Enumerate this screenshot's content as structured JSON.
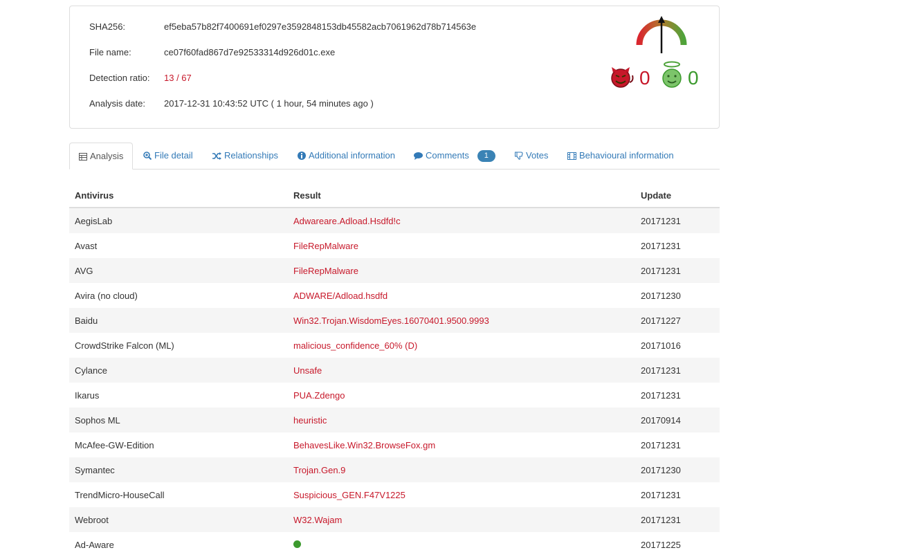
{
  "summary": {
    "sha256_label": "SHA256:",
    "sha256_value": "ef5eba57b82f7400691ef0297e3592848153db45582acb7061962d78b714563e",
    "filename_label": "File name:",
    "filename_value": "ce07f60fad867d7e92533314d926d01c.exe",
    "ratio_label": "Detection ratio:",
    "ratio_value": "13 / 67",
    "date_label": "Analysis date:",
    "date_value": "2017-12-31 10:43:52 UTC ( 1 hour, 54 minutes ago )"
  },
  "votes": {
    "malicious_count": "0",
    "harmless_count": "0",
    "malicious_color": "#c7182a",
    "harmless_color": "#3c9a2e"
  },
  "tabs": [
    {
      "label": "Analysis",
      "icon": "table-icon",
      "active": true
    },
    {
      "label": "File detail",
      "icon": "search-plus-icon"
    },
    {
      "label": "Relationships",
      "icon": "random-icon"
    },
    {
      "label": "Additional information",
      "icon": "info-circle-icon"
    },
    {
      "label": "Comments",
      "icon": "comment-icon",
      "badge": "1"
    },
    {
      "label": "Votes",
      "icon": "thumbs-down-icon"
    },
    {
      "label": "Behavioural information",
      "icon": "film-icon"
    }
  ],
  "table": {
    "headers": [
      "Antivirus",
      "Result",
      "Update"
    ],
    "rows": [
      {
        "av": "AegisLab",
        "result": "Adwareare.Adload.Hsdfd!c",
        "update": "20171231"
      },
      {
        "av": "Avast",
        "result": "FileRepMalware",
        "update": "20171231"
      },
      {
        "av": "AVG",
        "result": "FileRepMalware",
        "update": "20171231"
      },
      {
        "av": "Avira (no cloud)",
        "result": "ADWARE/Adload.hsdfd",
        "update": "20171230"
      },
      {
        "av": "Baidu",
        "result": "Win32.Trojan.WisdomEyes.16070401.9500.9993",
        "update": "20171227"
      },
      {
        "av": "CrowdStrike Falcon (ML)",
        "result": "malicious_confidence_60% (D)",
        "update": "20171016"
      },
      {
        "av": "Cylance",
        "result": "Unsafe",
        "update": "20171231"
      },
      {
        "av": "Ikarus",
        "result": "PUA.Zdengo",
        "update": "20171231"
      },
      {
        "av": "Sophos ML",
        "result": "heuristic",
        "update": "20170914"
      },
      {
        "av": "McAfee-GW-Edition",
        "result": "BehavesLike.Win32.BrowseFox.gm",
        "update": "20171231"
      },
      {
        "av": "Symantec",
        "result": "Trojan.Gen.9",
        "update": "20171230"
      },
      {
        "av": "TrendMicro-HouseCall",
        "result": "Suspicious_GEN.F47V1225",
        "update": "20171231"
      },
      {
        "av": "Webroot",
        "result": "W32.Wajam",
        "update": "20171231"
      },
      {
        "av": "Ad-Aware",
        "result": "",
        "clean": true,
        "update": "20171225"
      }
    ]
  }
}
